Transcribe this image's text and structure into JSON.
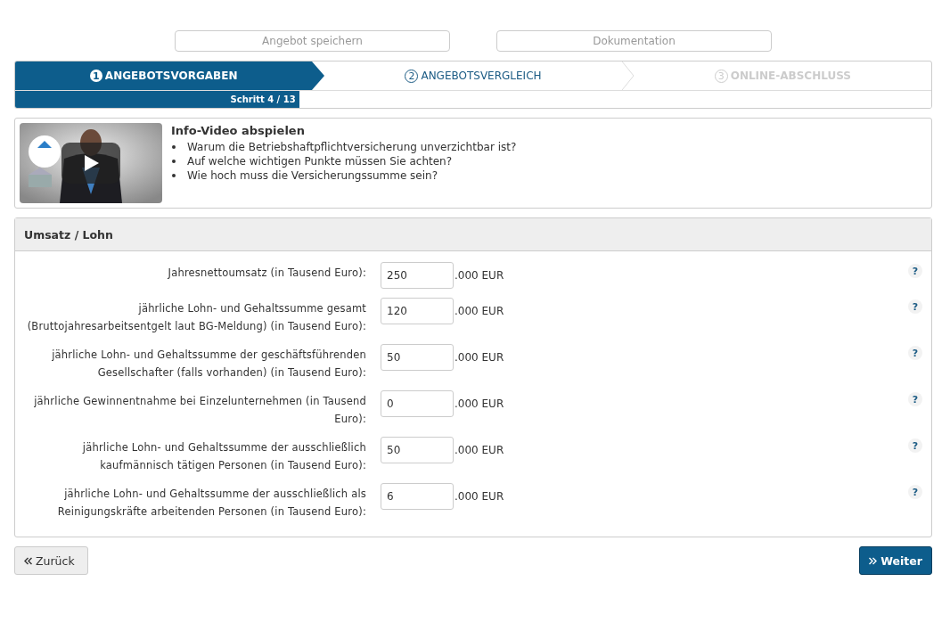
{
  "top_buttons": [
    "Angebot speichern",
    "Dokumentation"
  ],
  "steps": [
    {
      "number": "1",
      "label": "ANGEBOTSVORGABEN",
      "selected": true,
      "disabled": false
    },
    {
      "number": "2",
      "label": "ANGEBOTSVERGLEICH",
      "selected": false,
      "disabled": false
    },
    {
      "number": "3",
      "label": "ONLINE-ABSCHLUSS",
      "selected": false,
      "disabled": true
    }
  ],
  "progress": {
    "label": "Schritt 4 / 13",
    "level": 0.31
  },
  "info_video": {
    "title": "Info-Video abspielen",
    "points": [
      "Warum die Betriebshaftpflichtversicherung unverzichtbar ist?",
      "Auf welche wichtigen Punkte müssen Sie achten?",
      "Wie hoch muss die Versicherungssumme sein?"
    ]
  },
  "section": {
    "title": "Umsatz / Lohn",
    "fields": [
      {
        "label": "Jahresnettoumsatz (in Tausend Euro):",
        "value": "250",
        "unit": ".000 EUR",
        "help": "?"
      },
      {
        "label": "jährliche Lohn- und Gehaltssumme gesamt (Bruttojahresarbeitsentgelt laut BG-Meldung) (in Tausend Euro):",
        "value": "120",
        "unit": ".000 EUR",
        "help": "?"
      },
      {
        "label": "jährliche Lohn- und Gehaltssumme der geschäftsführenden Gesellschafter (falls vorhanden) (in Tausend Euro):",
        "value": "50",
        "unit": ".000 EUR",
        "help": "?"
      },
      {
        "label": "jährliche Gewinnentnahme bei Einzelunternehmen (in Tausend Euro):",
        "value": "0",
        "unit": ".000 EUR",
        "help": "?"
      },
      {
        "label": "jährliche Lohn- und Gehaltssumme der ausschließlich kaufmännisch tätigen Personen (in Tausend Euro):",
        "value": "50",
        "unit": ".000 EUR",
        "help": "?"
      },
      {
        "label": "jährliche Lohn- und Gehaltssumme der ausschließlich als Reinigungskräfte arbeitenden Personen (in Tausend Euro):",
        "value": "6",
        "unit": ".000 EUR",
        "help": "?"
      }
    ]
  },
  "back_button": "Zurück",
  "next_button": "Weiter"
}
